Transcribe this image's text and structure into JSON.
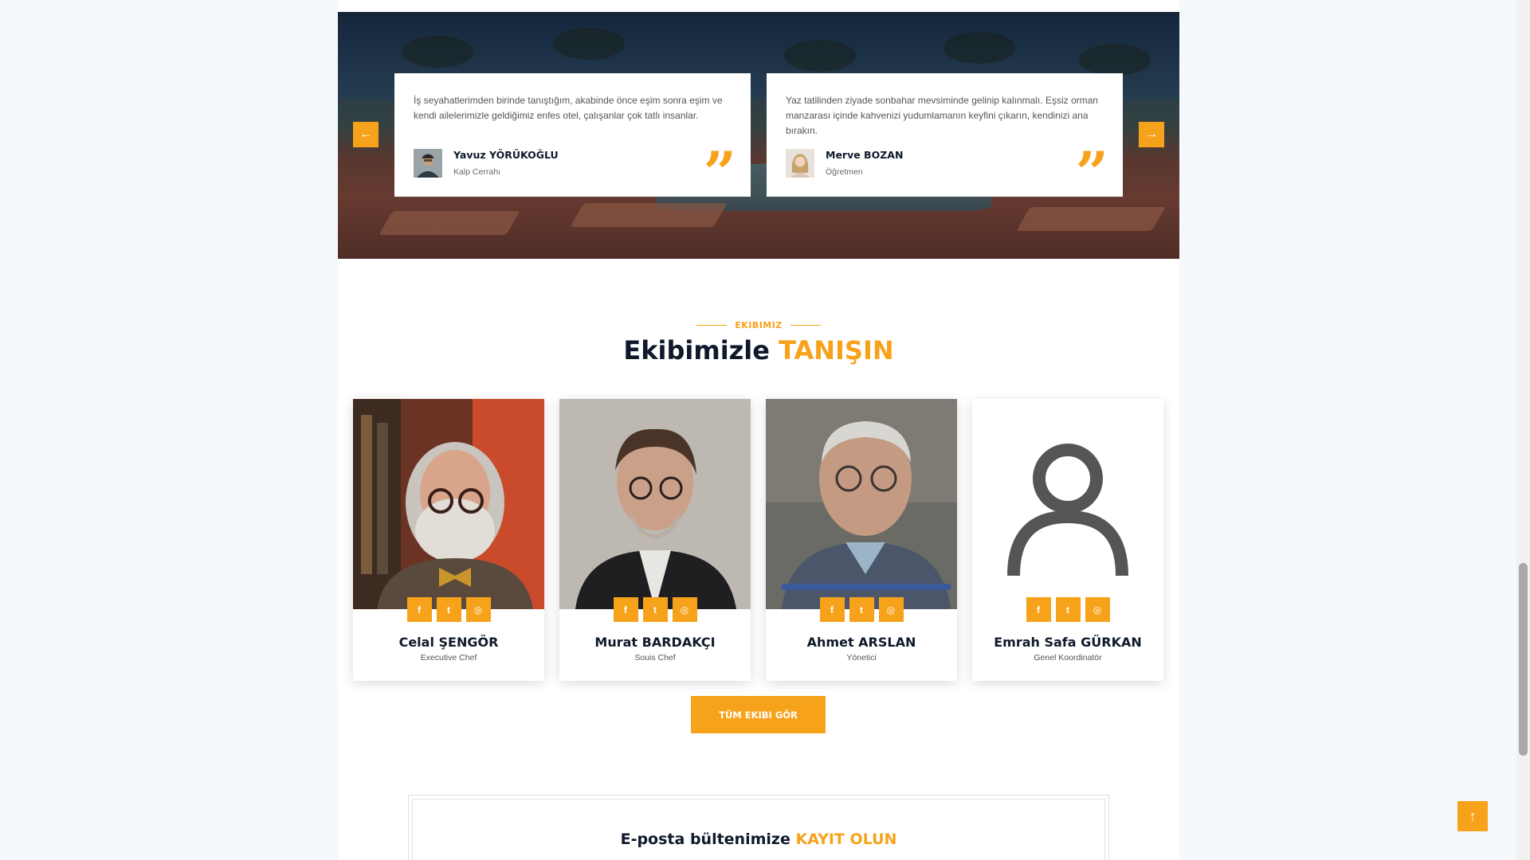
{
  "testimonials": {
    "prev_icon": "arrow-left-icon",
    "next_icon": "arrow-right-icon",
    "prev_glyph": "←",
    "next_glyph": "→",
    "items": [
      {
        "text": "İş seyahatlerimden birinde tanıştığım, akabinde önce eşim sonra eşim ve kendi ailelerimizle geldiğimiz enfes otel, çalışanlar çok tatlı insanlar.",
        "name": "Yavuz YÖRÜKOĞLU",
        "role": "Kalp Cerrahı"
      },
      {
        "text": "Yaz tatilinden ziyade sonbahar mevsiminde gelinip kalınmalı. Eşsiz orman manzarası içinde kahvenizi yudumlamanın keyfini çıkarın, kendinizi ana bırakın.",
        "name": "Merve BOZAN",
        "role": "Öğretmen"
      }
    ],
    "quote_glyph": "”"
  },
  "team": {
    "eyebrow": "EKIBIMIZ",
    "title_main": "Ekibimizle ",
    "title_highlight": "TANIŞIN",
    "social_glyphs": {
      "facebook": "f",
      "twitter": "t",
      "instagram": "◎"
    },
    "members": [
      {
        "name": "Celal ŞENGÖR",
        "role": "Executive Chef"
      },
      {
        "name": "Murat BARDAKÇI",
        "role": "Souis Chef"
      },
      {
        "name": "Ahmet ARSLAN",
        "role": "Yönetici"
      },
      {
        "name": "Emrah Safa GÜRKAN",
        "role": "Genel Koordinatör"
      }
    ],
    "cta_label": "TÜM EKIBI GÖR"
  },
  "newsletter": {
    "title_main": "E-posta bültenimize ",
    "title_highlight": "KAYIT OLUN"
  },
  "back_to_top_glyph": "↑",
  "colors": {
    "accent": "#f7a21b",
    "dark": "#0e1a2b"
  }
}
